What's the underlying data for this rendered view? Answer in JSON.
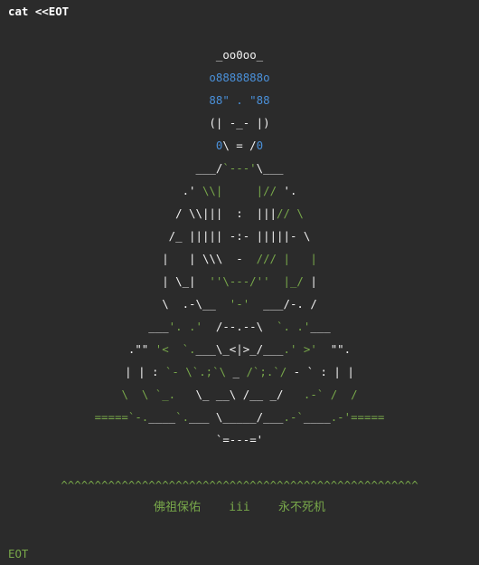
{
  "terminal": {
    "command": "cat <<EOT",
    "end_marker": "EOT",
    "banner": "^^^^^^^^^^^^^^^^^^^^^^^^^^^^^^^^^^^^^^^^^^^^^^^^^^^^^",
    "blessing": "佛祖保佑    iii    永不死机",
    "art_lines": [
      [
        [
          "w",
          "_oo0oo_"
        ]
      ],
      [
        [
          "b",
          "o8888888o"
        ]
      ],
      [
        [
          "b",
          "88\" . \"88"
        ]
      ],
      [
        [
          "w",
          "(| -_- |)"
        ]
      ],
      [
        [
          "b",
          "0"
        ],
        [
          "w",
          "\\ = /"
        ],
        [
          "b",
          "0"
        ]
      ],
      [
        [
          "w",
          "___/"
        ],
        [
          "g",
          "`---'"
        ],
        [
          "w",
          "\\___"
        ]
      ],
      [
        [
          "w",
          ".' "
        ],
        [
          "g",
          "\\\\|     |//"
        ],
        [
          "w",
          " '."
        ]
      ],
      [
        [
          "w",
          "/ \\\\||| "
        ],
        [
          "w",
          " :  "
        ],
        [
          "w",
          "|||"
        ],
        [
          "g",
          "// \\"
        ]
      ],
      [
        [
          "w",
          "/_ ||||| -:- |||||- \\"
        ]
      ],
      [
        [
          "w",
          "|   | \\\\\\  -  "
        ],
        [
          "g",
          "/// |   |"
        ]
      ],
      [
        [
          "w",
          "| \\_|  "
        ],
        [
          "g",
          "''\\---/''"
        ],
        [
          "w",
          "  "
        ],
        [
          "g",
          "|_/"
        ],
        [
          "w",
          " |"
        ]
      ],
      [
        [
          "w",
          "\\  .-\\__  "
        ],
        [
          "g",
          "'-'"
        ],
        [
          "w",
          "  ___/-. /"
        ]
      ],
      [
        [
          "w",
          "___"
        ],
        [
          "g",
          "'. .'"
        ],
        [
          "w",
          "  /--.--\\  "
        ],
        [
          "g",
          "`. .'"
        ],
        [
          "w",
          "___"
        ]
      ],
      [
        [
          "w",
          ".\"\" "
        ],
        [
          "g",
          "'<  `."
        ],
        [
          "w",
          "___\\_<|>_/___"
        ],
        [
          "g",
          ".' >'"
        ],
        [
          "w",
          "  \"\"."
        ]
      ],
      [
        [
          "w",
          "| | : "
        ],
        [
          "g",
          "`- \\`.;`\\"
        ],
        [
          "w",
          " _ "
        ],
        [
          "g",
          "/`;.`/"
        ],
        [
          "w",
          " - ` : | |"
        ]
      ],
      [
        [
          "g",
          "\\  \\ `_.   "
        ],
        [
          "w",
          "\\_ __\\ /__ _/"
        ],
        [
          "g",
          "   .-` /  /"
        ]
      ],
      [
        [
          "g",
          "=====`-."
        ],
        [
          "w",
          "____"
        ],
        [
          "g",
          "`."
        ],
        [
          "w",
          "___ \\_____/___"
        ],
        [
          "g",
          ".-`"
        ],
        [
          "w",
          "____"
        ],
        [
          "g",
          ".-'====="
        ]
      ],
      [
        [
          "w",
          "`=---='"
        ]
      ]
    ]
  },
  "colors": {
    "background": "#2b2b2b",
    "white": "#f2f2f2",
    "blue": "#4a90d9",
    "green": "#78a84a"
  }
}
